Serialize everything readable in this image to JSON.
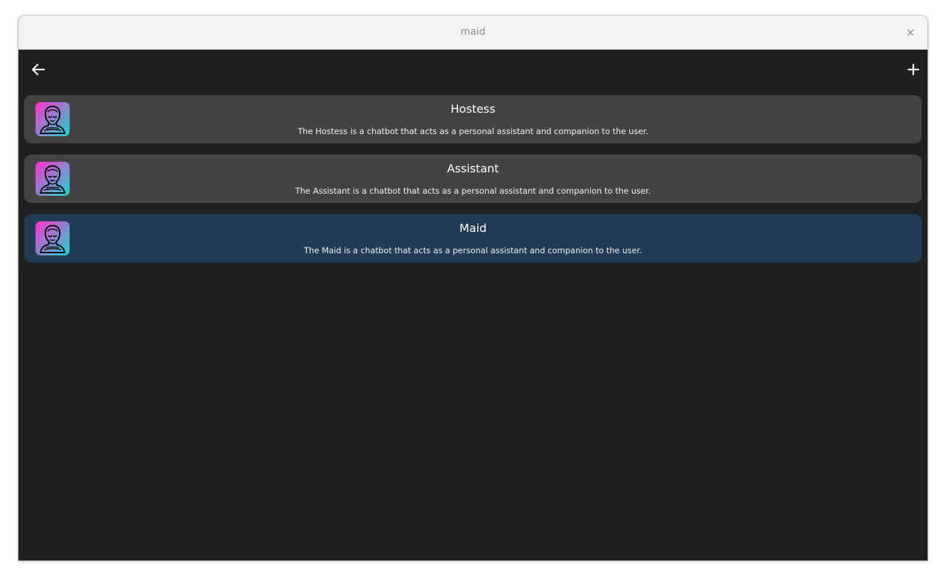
{
  "window": {
    "title": "maid",
    "close_label": "×"
  },
  "toolbar": {
    "back_icon": "arrow-left-icon",
    "add_icon": "plus-icon"
  },
  "characters": [
    {
      "name": "Hostess",
      "description": "The Hostess is a chatbot that acts as a personal assistant and companion to the user.",
      "avatar_icon": "character-avatar",
      "selected": false
    },
    {
      "name": "Assistant",
      "description": "The Assistant is a chatbot that acts as a personal assistant and companion to the user.",
      "avatar_icon": "character-avatar",
      "selected": false
    },
    {
      "name": "Maid",
      "description": "The Maid is a chatbot that acts as a personal assistant and companion to the user.",
      "avatar_icon": "character-avatar",
      "selected": true
    }
  ],
  "colors": {
    "background": "#202020",
    "card": "#434343",
    "card_selected": "#213d56",
    "avatar_gradient_start": "#ff2fd0",
    "avatar_gradient_end": "#1fd6d0"
  }
}
